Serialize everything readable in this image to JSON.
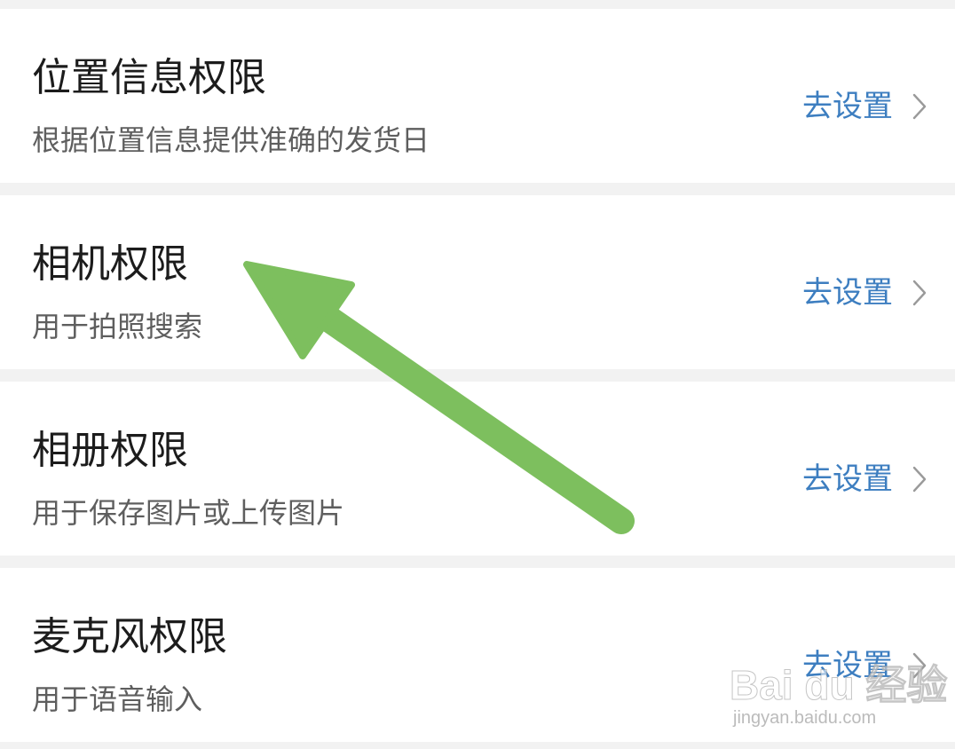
{
  "permissions": [
    {
      "title": "位置信息权限",
      "description": "根据位置信息提供准确的发货日",
      "action": "去设置"
    },
    {
      "title": "相机权限",
      "description": "用于拍照搜索",
      "action": "去设置"
    },
    {
      "title": "相册权限",
      "description": "用于保存图片或上传图片",
      "action": "去设置"
    },
    {
      "title": "麦克风权限",
      "description": "用于语音输入",
      "action": "去设置"
    }
  ],
  "icons": {
    "chevron": "chevron-right-icon",
    "annotation_arrow": "arrow-annotation-icon"
  },
  "colors": {
    "background": "#f2f2f2",
    "card": "#ffffff",
    "title": "#1c1c1c",
    "description": "#5e5e5e",
    "action": "#3d7ec0",
    "chevron": "#9a9a9a",
    "annotation_arrow": "#7dbf5e"
  },
  "watermark": {
    "main": "Bai du 经验",
    "sub": "jingyan.baidu.com"
  }
}
